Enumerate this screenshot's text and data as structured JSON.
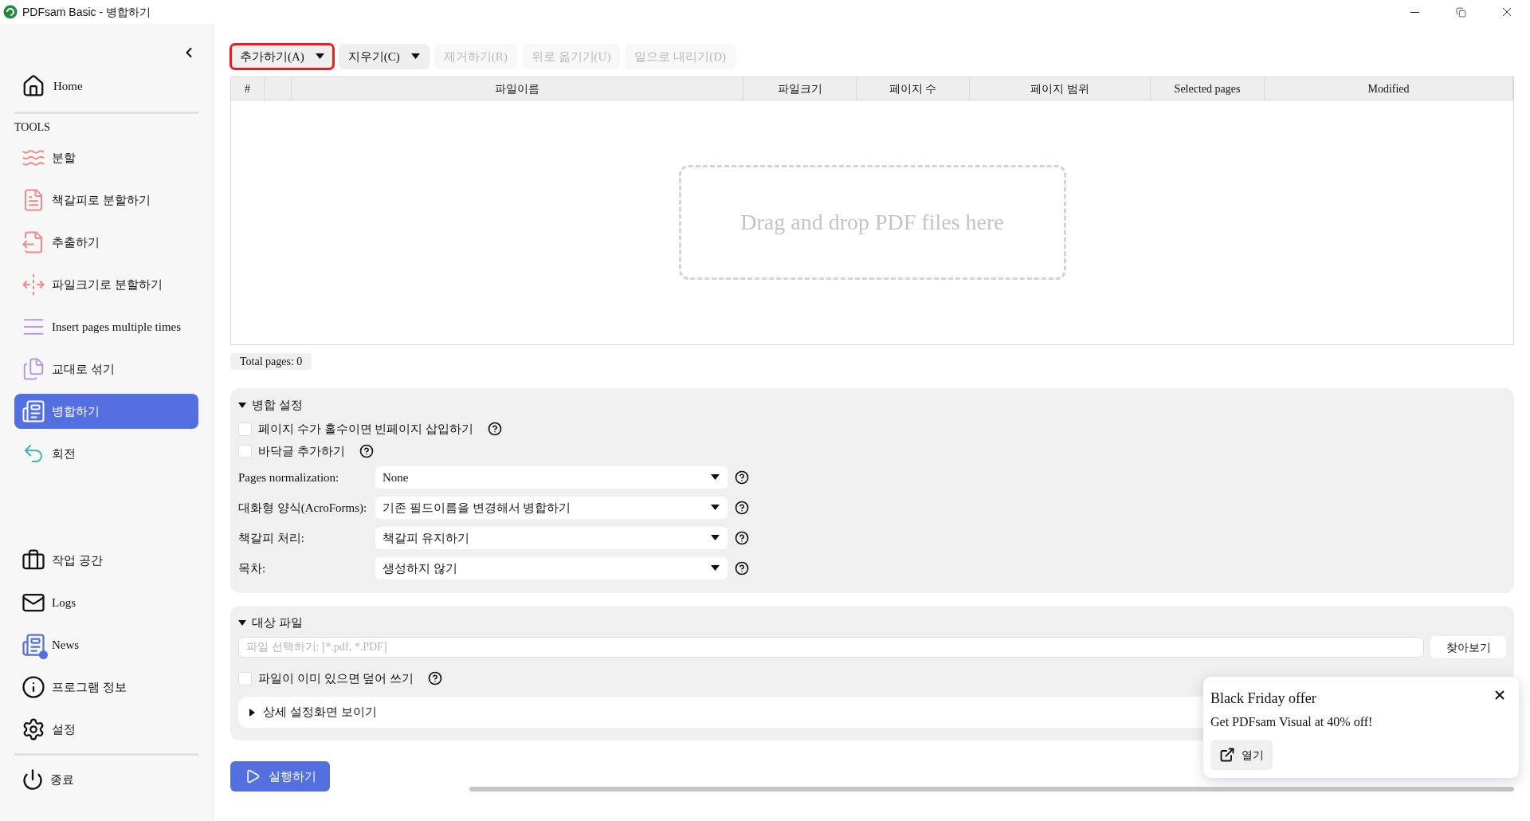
{
  "window": {
    "title": "PDFsam Basic - 병합하기"
  },
  "sidebar": {
    "home": "Home",
    "tools_heading": "TOOLS",
    "tools": [
      {
        "label": "분할",
        "kind": "split",
        "color": "#f08a8a",
        "selected": false
      },
      {
        "label": "책갈피로 분할하기",
        "kind": "bookmarks",
        "color": "#f08a8a",
        "selected": false
      },
      {
        "label": "추출하기",
        "kind": "extract",
        "color": "#f08a8a",
        "selected": false
      },
      {
        "label": "파일크기로 분할하기",
        "kind": "size",
        "color": "#f08a8a",
        "selected": false
      },
      {
        "label": "Insert pages multiple times",
        "kind": "insert",
        "color": "#b59ae0",
        "selected": false
      },
      {
        "label": "교대로 섞기",
        "kind": "alternate",
        "color": "#b59ae0",
        "selected": false
      },
      {
        "label": "병합하기",
        "kind": "merge",
        "color": "#5470e0",
        "selected": true
      },
      {
        "label": "회전",
        "kind": "rotate",
        "color": "#3fb5a8",
        "selected": false
      }
    ],
    "bottom": [
      {
        "label": "작업 공간",
        "kind": "workspace",
        "unread": false
      },
      {
        "label": "Logs",
        "kind": "logs",
        "unread": false
      },
      {
        "label": "News",
        "kind": "news",
        "unread": true
      },
      {
        "label": "프로그램 정보",
        "kind": "about",
        "unread": false
      },
      {
        "label": "설정",
        "kind": "settings",
        "unread": false
      }
    ],
    "exit": "종료"
  },
  "toolbar": [
    {
      "label": "추가하기(A)",
      "dropdown": true,
      "disabled": false,
      "focused": true
    },
    {
      "label": "지우기(C)",
      "dropdown": true,
      "disabled": false,
      "focused": false
    },
    {
      "label": "제거하기(R)",
      "dropdown": false,
      "disabled": true,
      "focused": false
    },
    {
      "label": "위로 옮기기(U)",
      "dropdown": false,
      "disabled": true,
      "focused": false
    },
    {
      "label": "밑으로 내리기(D)",
      "dropdown": false,
      "disabled": true,
      "focused": false
    }
  ],
  "table": {
    "columns": [
      "#",
      "파일이름",
      "파일크기",
      "페이지 수",
      "페이지 범위",
      "Selected pages",
      "Modified"
    ],
    "drop_hint": "Drag and drop PDF files here"
  },
  "total_pages": "Total pages: 0",
  "merge_settings": {
    "title": "병합 설정",
    "expanded": true,
    "checkboxes": [
      {
        "label": "페이지 수가 홀수이면 빈페이지 삽입하기",
        "checked": false
      },
      {
        "label": "바닥글 추가하기",
        "checked": false
      }
    ],
    "selects": [
      {
        "label": "Pages normalization:",
        "value": "None"
      },
      {
        "label": "대화형 양식(AcroForms):",
        "value": "기존 필드이름을 변경해서 병합하기"
      },
      {
        "label": "책갈피 처리:",
        "value": "책갈피 유지하기"
      },
      {
        "label": "목차:",
        "value": "생성하지 않기"
      }
    ]
  },
  "target": {
    "title": "대상 파일",
    "expanded": true,
    "file_field": {
      "placeholder": "파일 선택하기: [*.pdf, *.PDF]"
    },
    "browse_button": "찾아보기",
    "overwrite": {
      "label": "파일이 이미 있으면 덮어 쓰기",
      "checked": false
    },
    "advanced": {
      "label": "상세 설정화면 보이기",
      "expanded": false
    }
  },
  "run_button": "실행하기",
  "popup": {
    "title": "Black Friday offer",
    "message": "Get PDFsam Visual at 40% off!",
    "open_button": "열기"
  }
}
